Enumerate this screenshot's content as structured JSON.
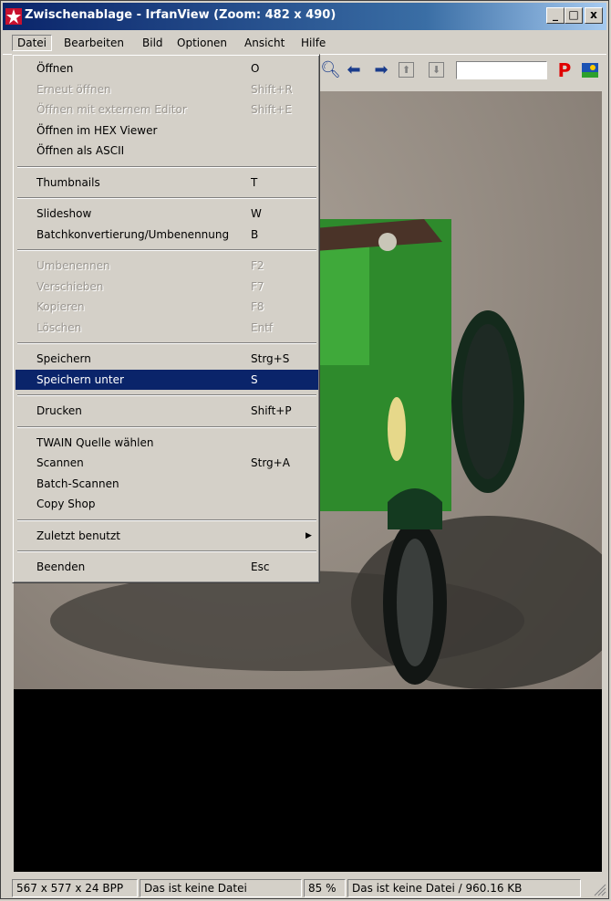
{
  "window": {
    "title": "Zwischenablage - IrfanView (Zoom: 482 x 490)",
    "buttons": {
      "minimize": "_",
      "maximize": "□",
      "close": "x"
    }
  },
  "menubar": [
    "Datei",
    "Bearbeiten",
    "Bild",
    "Optionen",
    "Ansicht",
    "Hilfe"
  ],
  "toolbar": {
    "letter_p": "P"
  },
  "file_menu": {
    "items": [
      {
        "label": "Öffnen",
        "shortcut": "O",
        "state": "enabled"
      },
      {
        "label": "Erneut öffnen",
        "shortcut": "Shift+R",
        "state": "disabled"
      },
      {
        "label": "Öffnen mit externem Editor",
        "shortcut": "Shift+E",
        "state": "disabled"
      },
      {
        "label": "Öffnen im HEX Viewer",
        "shortcut": "",
        "state": "enabled"
      },
      {
        "label": "Öffnen als ASCII",
        "shortcut": "",
        "state": "enabled"
      },
      {
        "label": "Thumbnails",
        "shortcut": "T",
        "state": "enabled"
      },
      {
        "label": "Slideshow",
        "shortcut": "W",
        "state": "enabled"
      },
      {
        "label": "Batchkonvertierung/Umbenennung",
        "shortcut": "B",
        "state": "enabled"
      },
      {
        "label": "Umbenennen",
        "shortcut": "F2",
        "state": "disabled"
      },
      {
        "label": "Verschieben",
        "shortcut": "F7",
        "state": "disabled"
      },
      {
        "label": "Kopieren",
        "shortcut": "F8",
        "state": "disabled"
      },
      {
        "label": "Löschen",
        "shortcut": "Entf",
        "state": "disabled"
      },
      {
        "label": "Speichern",
        "shortcut": "Strg+S",
        "state": "enabled"
      },
      {
        "label": "Speichern unter",
        "shortcut": "S",
        "state": "selected"
      },
      {
        "label": "Drucken",
        "shortcut": "Shift+P",
        "state": "enabled"
      },
      {
        "label": "TWAIN Quelle wählen",
        "shortcut": "",
        "state": "enabled"
      },
      {
        "label": "Scannen",
        "shortcut": "Strg+A",
        "state": "enabled"
      },
      {
        "label": "Batch-Scannen",
        "shortcut": "",
        "state": "enabled"
      },
      {
        "label": "Copy Shop",
        "shortcut": "",
        "state": "enabled"
      },
      {
        "label": "Zuletzt benutzt",
        "shortcut": "",
        "state": "submenu"
      },
      {
        "label": "Beenden",
        "shortcut": "Esc",
        "state": "enabled"
      }
    ]
  },
  "statusbar": {
    "dimensions": "567 x 577 x 24 BPP",
    "file_info": "Das ist keine Datei",
    "zoom": "85 %",
    "file_size_info": "Das ist keine Datei / 960.16 KB"
  },
  "colors": {
    "selection": "#0a246a",
    "titlebar": "#0a246a",
    "car_green": "#3f9a3a"
  }
}
